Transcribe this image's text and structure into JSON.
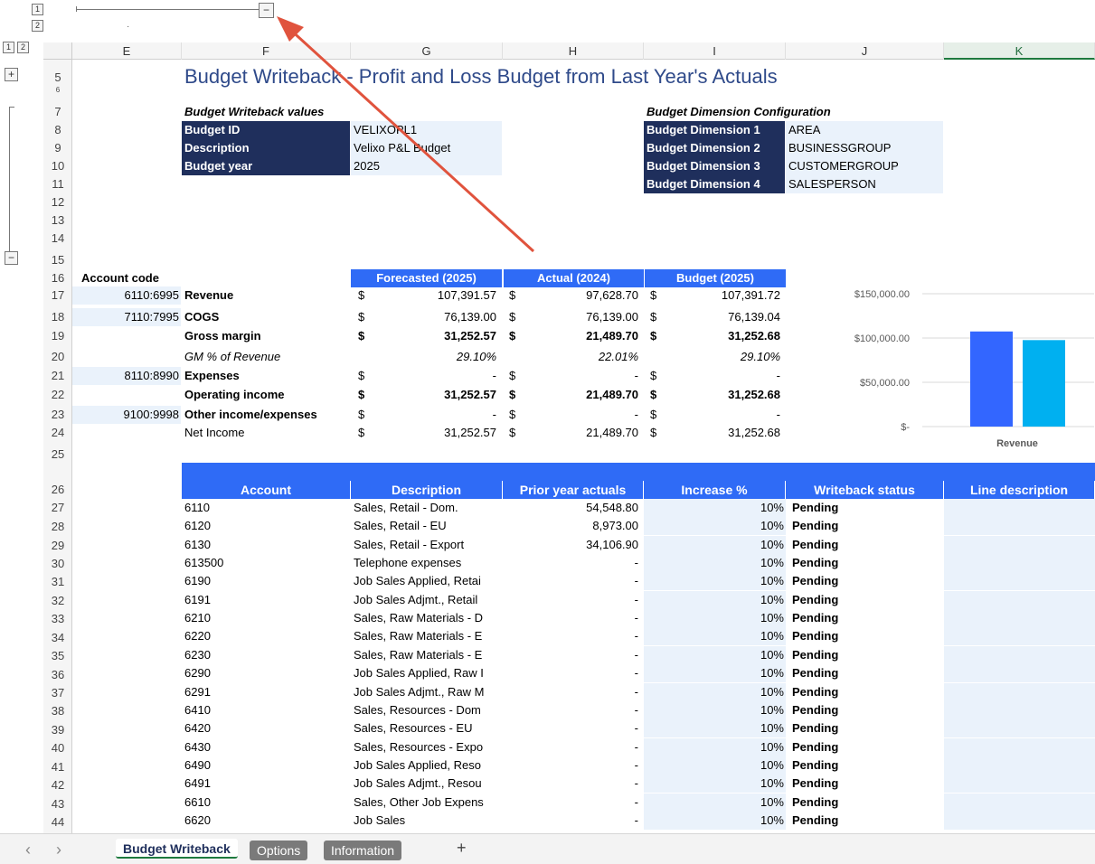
{
  "outline": {
    "levels_top": [
      "1",
      "2"
    ],
    "levels_left": [
      "1",
      "2"
    ],
    "expand": "+",
    "collapse": "−"
  },
  "columns": [
    "E",
    "F",
    "G",
    "H",
    "I",
    "J",
    "K"
  ],
  "rows": [
    "5",
    "6",
    "7",
    "8",
    "9",
    "10",
    "11",
    "12",
    "13",
    "14",
    "15",
    "16",
    "17",
    "18",
    "19",
    "20",
    "21",
    "22",
    "23",
    "24",
    "25",
    "26",
    "27",
    "28",
    "29",
    "30",
    "31",
    "32",
    "33",
    "34",
    "35",
    "36",
    "37",
    "38",
    "39",
    "40",
    "41",
    "42",
    "43",
    "44"
  ],
  "title": "Budget Writeback - Profit and Loss Budget from Last Year's Actuals",
  "writeback_values": {
    "heading": "Budget Writeback values",
    "items": [
      {
        "label": "Budget ID",
        "value": "VELIXOPL1"
      },
      {
        "label": "Description",
        "value": "Velixo P&L Budget"
      },
      {
        "label": "Budget year",
        "value": "2025"
      }
    ]
  },
  "dimension_config": {
    "heading": "Budget Dimension Configuration",
    "items": [
      {
        "label": "Budget Dimension 1",
        "value": "AREA"
      },
      {
        "label": "Budget Dimension 2",
        "value": "BUSINESSGROUP"
      },
      {
        "label": "Budget Dimension 3",
        "value": "CUSTOMERGROUP"
      },
      {
        "label": "Budget Dimension 4",
        "value": "SALESPERSON"
      }
    ]
  },
  "summary": {
    "account_code_header": "Account code",
    "headers": [
      "Forecasted (2025)",
      "Actual (2024)",
      "Budget (2025)"
    ],
    "rows": [
      {
        "code": "6110:6995",
        "label": "Revenue",
        "cur": [
          "$",
          "$",
          "$"
        ],
        "vals": [
          "107,391.57",
          "97,628.70",
          "107,391.72"
        ]
      },
      {
        "code": "7110:7995",
        "label": "COGS",
        "cur": [
          "$",
          "$",
          "$"
        ],
        "vals": [
          "76,139.00",
          "76,139.00",
          "76,139.04"
        ]
      },
      {
        "code": "",
        "label": "Gross margin",
        "cur": [
          "$",
          "$",
          "$"
        ],
        "vals": [
          "31,252.57",
          "21,489.70",
          "31,252.68"
        ]
      },
      {
        "code": "",
        "label": "GM % of Revenue",
        "cur": [
          "",
          "",
          ""
        ],
        "vals": [
          "29.10%",
          "22.01%",
          "29.10%"
        ]
      },
      {
        "code": "8110:8990",
        "label": "Expenses",
        "cur": [
          "$",
          "$",
          "$"
        ],
        "vals": [
          "-",
          "-",
          "-"
        ]
      },
      {
        "code": "",
        "label": "Operating income",
        "cur": [
          "$",
          "$",
          "$"
        ],
        "vals": [
          "31,252.57",
          "21,489.70",
          "31,252.68"
        ]
      },
      {
        "code": "9100:9998",
        "label": "Other income/expenses",
        "cur": [
          "$",
          "$",
          "$"
        ],
        "vals": [
          "-",
          "-",
          "-"
        ]
      },
      {
        "code": "",
        "label": "Net Income",
        "cur": [
          "$",
          "$",
          "$"
        ],
        "vals": [
          "31,252.57",
          "21,489.70",
          "31,252.68"
        ]
      }
    ]
  },
  "chart_data": {
    "type": "bar",
    "categories": [
      "Revenue"
    ],
    "series": [
      {
        "values": [
          107391.57
        ],
        "color": "#3366ff"
      },
      {
        "values": [
          97628.7
        ],
        "color": "#00b0f0"
      }
    ],
    "ytick_labels": [
      "$150,000.00",
      "$100,000.00",
      "$50,000.00",
      "$-"
    ],
    "yticks": [
      150000,
      100000,
      50000,
      0
    ],
    "ylim": [
      0,
      150000
    ],
    "xlabel_text": "Revenue"
  },
  "detail": {
    "headers": [
      "Account",
      "Description",
      "Prior year actuals",
      "Increase %",
      "Writeback status",
      "Line description"
    ],
    "rows": [
      [
        "6110",
        "Sales, Retail - Dom.",
        "54,548.80",
        "10%",
        "Pending"
      ],
      [
        "6120",
        "Sales, Retail - EU",
        "8,973.00",
        "10%",
        "Pending"
      ],
      [
        "6130",
        "Sales, Retail - Export",
        "34,106.90",
        "10%",
        "Pending"
      ],
      [
        "613500",
        "Telephone expenses",
        "-",
        "10%",
        "Pending"
      ],
      [
        "6190",
        "Job Sales Applied, Retai",
        "-",
        "10%",
        "Pending"
      ],
      [
        "6191",
        "Job Sales Adjmt., Retail",
        "-",
        "10%",
        "Pending"
      ],
      [
        "6210",
        "Sales, Raw Materials - D",
        "-",
        "10%",
        "Pending"
      ],
      [
        "6220",
        "Sales, Raw Materials - E",
        "-",
        "10%",
        "Pending"
      ],
      [
        "6230",
        "Sales, Raw Materials - E",
        "-",
        "10%",
        "Pending"
      ],
      [
        "6290",
        "Job Sales Applied, Raw I",
        "-",
        "10%",
        "Pending"
      ],
      [
        "6291",
        "Job Sales Adjmt., Raw M",
        "-",
        "10%",
        "Pending"
      ],
      [
        "6410",
        "Sales, Resources - Dom",
        "-",
        "10%",
        "Pending"
      ],
      [
        "6420",
        "Sales, Resources - EU",
        "-",
        "10%",
        "Pending"
      ],
      [
        "6430",
        "Sales, Resources - Expo",
        "-",
        "10%",
        "Pending"
      ],
      [
        "6490",
        "Job Sales Applied, Reso",
        "-",
        "10%",
        "Pending"
      ],
      [
        "6491",
        "Job Sales Adjmt., Resou",
        "-",
        "10%",
        "Pending"
      ],
      [
        "6610",
        "Sales, Other Job Expens",
        "-",
        "10%",
        "Pending"
      ],
      [
        "6620",
        "Job Sales",
        "-",
        "10%",
        "Pending"
      ]
    ]
  },
  "sheet_tabs": {
    "nav_prev": "‹",
    "nav_next": "›",
    "tabs": [
      "Budget Writeback",
      "Options",
      "Information"
    ],
    "active": "Budget Writeback",
    "add": "+"
  },
  "colors": {
    "navy": "#1f2f5c",
    "blue_header": "#2f6bf6",
    "light_fill": "#eaf2fb",
    "annotation_arrow": "#e0533d"
  }
}
